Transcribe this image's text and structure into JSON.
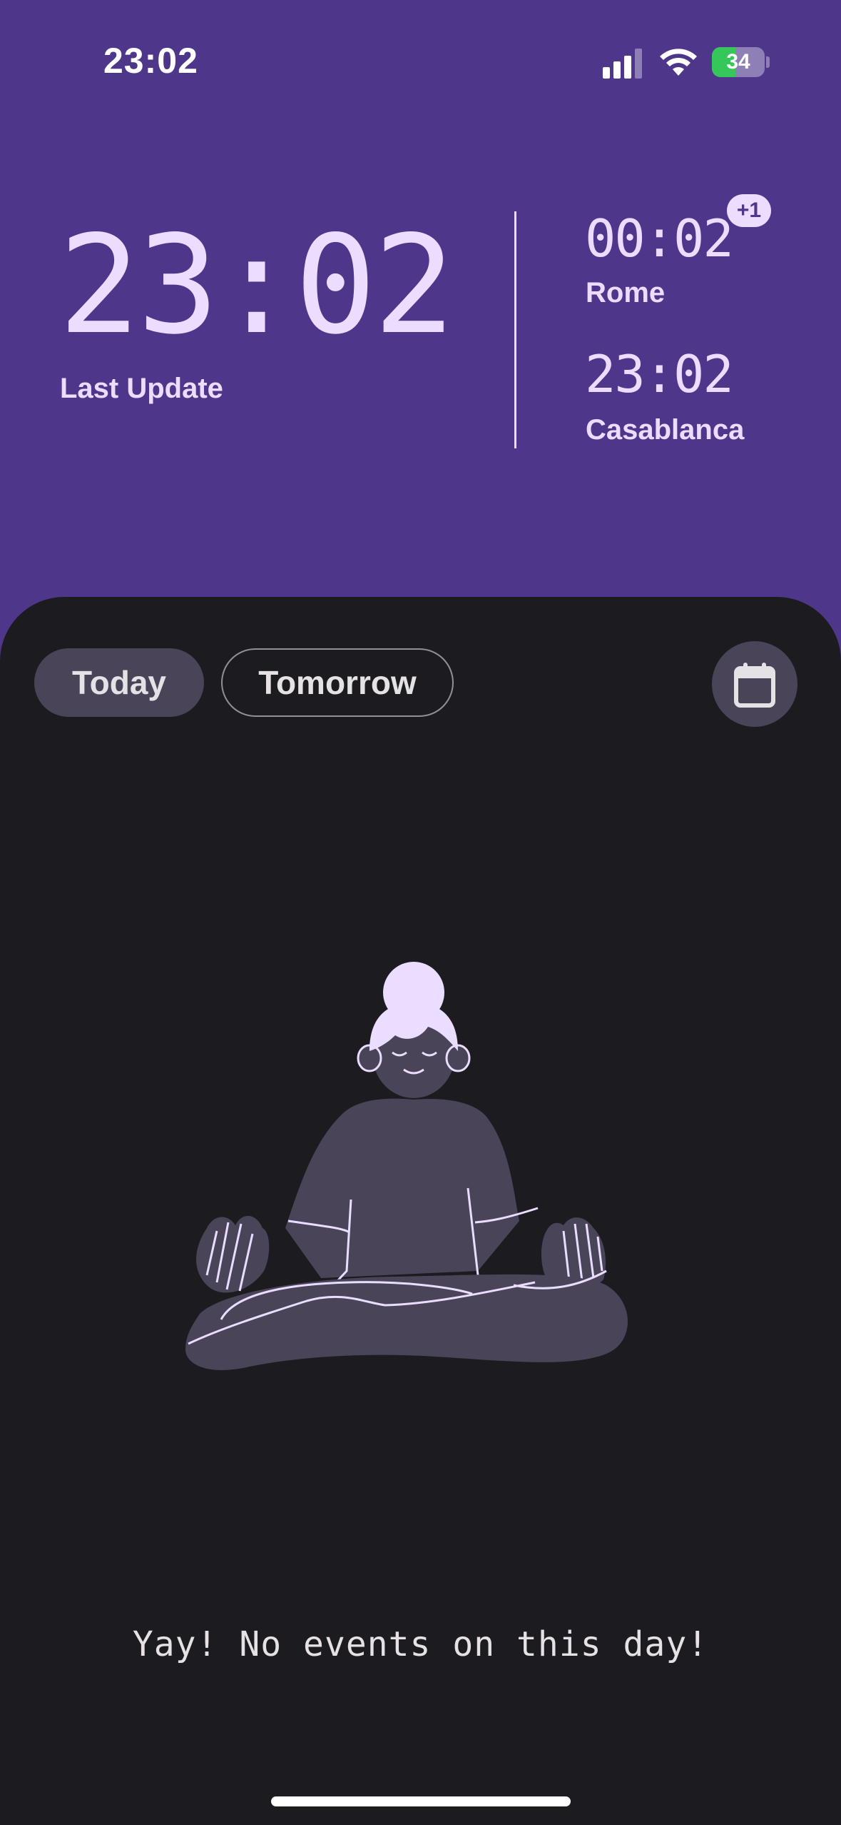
{
  "status_bar": {
    "time": "23:02",
    "battery_percent": "34",
    "battery_level": 0.34,
    "icons": [
      "signal-icon",
      "wifi-icon",
      "battery-charging-icon"
    ]
  },
  "clock": {
    "time": "23:02",
    "label": "Last Update"
  },
  "world_clocks": [
    {
      "time": "00:02",
      "city": "Rome",
      "day_offset": "+1"
    },
    {
      "time": "23:02",
      "city": "Casablanca"
    }
  ],
  "filters": {
    "today": "Today",
    "tomorrow": "Tomorrow",
    "selected": "Today"
  },
  "calendar_icon": "calendar-icon",
  "illustration_icon": "meditating-person-illustration",
  "empty_state": {
    "message": "Yay! No events on this day!"
  },
  "colors": {
    "header_bg": "#4e378a",
    "sheet_bg": "#1c1b1f",
    "accent_text": "#eaddff",
    "chip_selected": "#4a4458",
    "battery_green": "#35c759"
  }
}
